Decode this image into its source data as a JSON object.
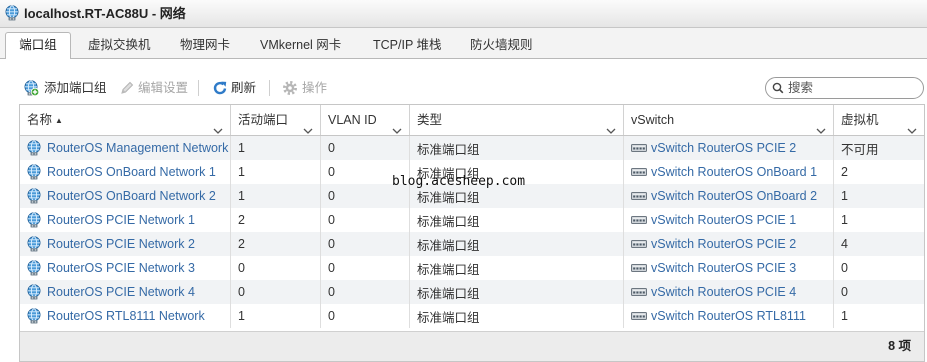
{
  "window": {
    "title": "localhost.RT-AC88U - 网络",
    "icon": "port-group-globe-icon"
  },
  "tabs": [
    {
      "label": "端口组",
      "active": true
    },
    {
      "label": "虚拟交换机"
    },
    {
      "label": "物理网卡"
    },
    {
      "label": "VMkernel 网卡"
    },
    {
      "label": "TCP/IP 堆栈"
    },
    {
      "label": "防火墙规则"
    }
  ],
  "toolbar": {
    "add_port_group": {
      "label": "添加端口组",
      "icon": "add-port-group-icon"
    },
    "edit_settings": {
      "label": "编辑设置",
      "icon": "pencil-icon",
      "disabled": true
    },
    "refresh": {
      "label": "刷新",
      "icon": "refresh-icon"
    },
    "actions": {
      "label": "操作",
      "icon": "gear-icon",
      "disabled": true
    }
  },
  "search": {
    "placeholder": "搜索",
    "value": "",
    "icon": "search-icon"
  },
  "table": {
    "columns": [
      {
        "label": "名称",
        "sort": "▲"
      },
      {
        "label": "活动端口"
      },
      {
        "label": "VLAN ID"
      },
      {
        "label": "类型"
      },
      {
        "label": "vSwitch"
      },
      {
        "label": "虚拟机"
      }
    ],
    "rows": [
      {
        "name": "RouterOS Management Network",
        "active_ports": "1",
        "vlan_id": "0",
        "type": "标准端口组",
        "vswitch": "vSwitch RouterOS PCIE 2",
        "vms": "不可用"
      },
      {
        "name": "RouterOS OnBoard Network 1",
        "active_ports": "1",
        "vlan_id": "0",
        "type": "标准端口组",
        "vswitch": "vSwitch RouterOS OnBoard 1",
        "vms": "2"
      },
      {
        "name": "RouterOS OnBoard Network 2",
        "active_ports": "1",
        "vlan_id": "0",
        "type": "标准端口组",
        "vswitch": "vSwitch RouterOS OnBoard 2",
        "vms": "1"
      },
      {
        "name": "RouterOS PCIE Network 1",
        "active_ports": "2",
        "vlan_id": "0",
        "type": "标准端口组",
        "vswitch": "vSwitch RouterOS PCIE 1",
        "vms": "1"
      },
      {
        "name": "RouterOS PCIE Network 2",
        "active_ports": "2",
        "vlan_id": "0",
        "type": "标准端口组",
        "vswitch": "vSwitch RouterOS PCIE 2",
        "vms": "4"
      },
      {
        "name": "RouterOS PCIE Network 3",
        "active_ports": "0",
        "vlan_id": "0",
        "type": "标准端口组",
        "vswitch": "vSwitch RouterOS PCIE 3",
        "vms": "0"
      },
      {
        "name": "RouterOS PCIE Network 4",
        "active_ports": "0",
        "vlan_id": "0",
        "type": "标准端口组",
        "vswitch": "vSwitch RouterOS PCIE 4",
        "vms": "0"
      },
      {
        "name": "RouterOS RTL8111 Network",
        "active_ports": "1",
        "vlan_id": "0",
        "type": "标准端口组",
        "vswitch": "vSwitch RouterOS RTL8111",
        "vms": "1"
      }
    ],
    "footer_count": "8 项"
  },
  "watermark": "blog.acesheep.com",
  "colors": {
    "link": "#356aa6",
    "disabled_text": "#a6a6a6",
    "row_alt": "#f1f3f5",
    "accent": "#2f7bc8"
  }
}
